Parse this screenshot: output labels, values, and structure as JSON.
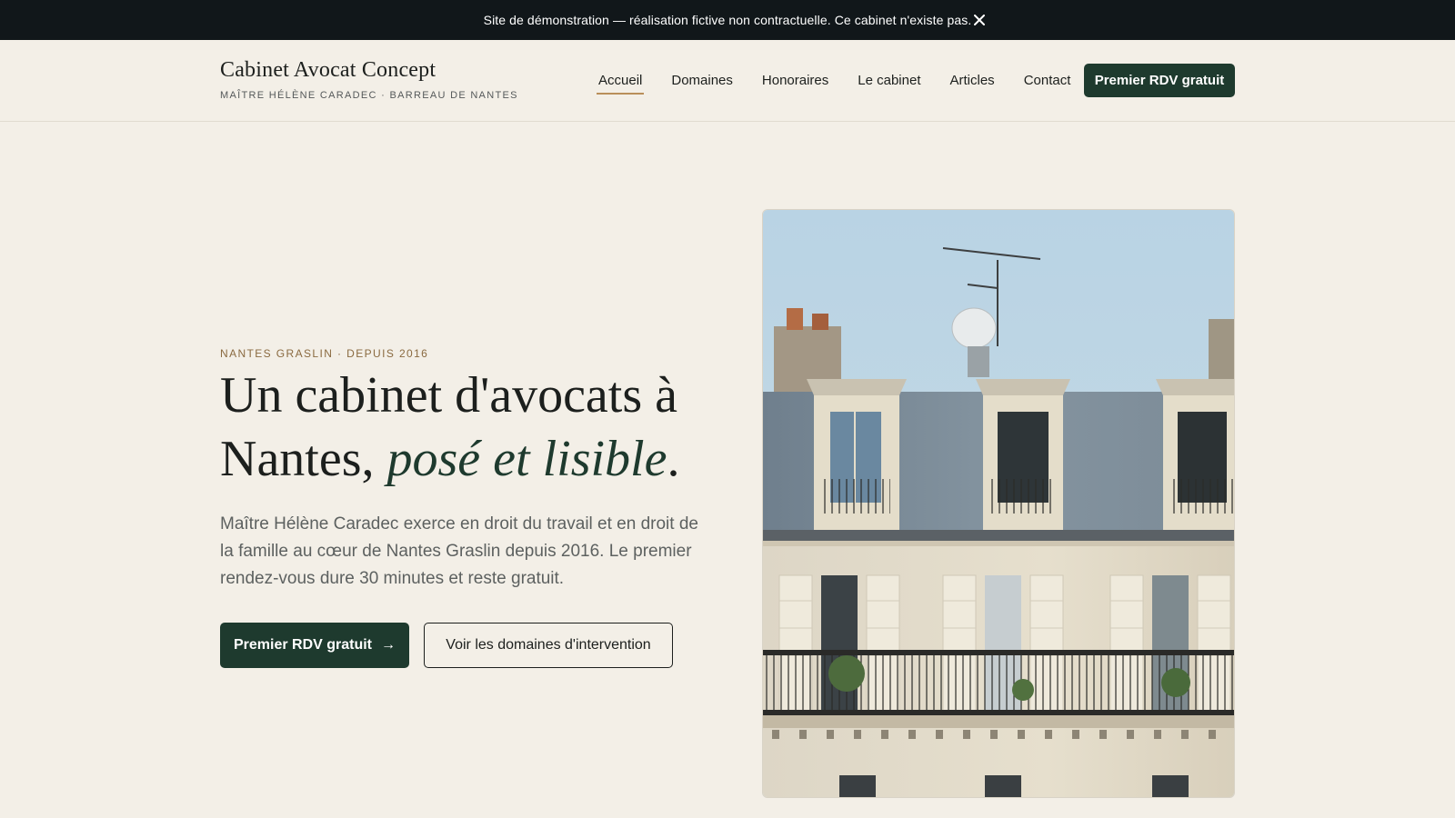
{
  "banner": {
    "text": "Site de démonstration — réalisation fictive non contractuelle. Ce cabinet n'existe pas.",
    "close_icon": "close-icon"
  },
  "header": {
    "brand_name": "Cabinet Avocat Concept",
    "brand_sub": "MAÎTRE HÉLÈNE CARADEC · BARREAU DE NANTES",
    "nav": [
      {
        "label": "Accueil",
        "active": true
      },
      {
        "label": "Domaines",
        "active": false
      },
      {
        "label": "Honoraires",
        "active": false
      },
      {
        "label": "Le cabinet",
        "active": false
      },
      {
        "label": "Articles",
        "active": false
      },
      {
        "label": "Contact",
        "active": false
      }
    ],
    "cta_label": "Premier RDV gratuit"
  },
  "hero": {
    "eyebrow": "NANTES GRASLIN · DEPUIS 2016",
    "headline_part1": "Un cabinet d'avocats à Nantes, ",
    "headline_emphasis": "posé et lisible",
    "headline_end": ".",
    "lede": "Maître Hélène Caradec exerce en droit du travail et en droit de la famille au cœur de Nantes Graslin depuis 2016. Le premier rendez-vous dure 30 minutes et reste gratuit.",
    "primary_button": "Premier RDV gratuit",
    "primary_arrow": "→",
    "secondary_button": "Voir les domaines d'intervention"
  },
  "colors": {
    "background": "#f3efe7",
    "banner": "#11171a",
    "brand_green": "#1e3a2e",
    "accent_gold": "#b98f5a"
  }
}
